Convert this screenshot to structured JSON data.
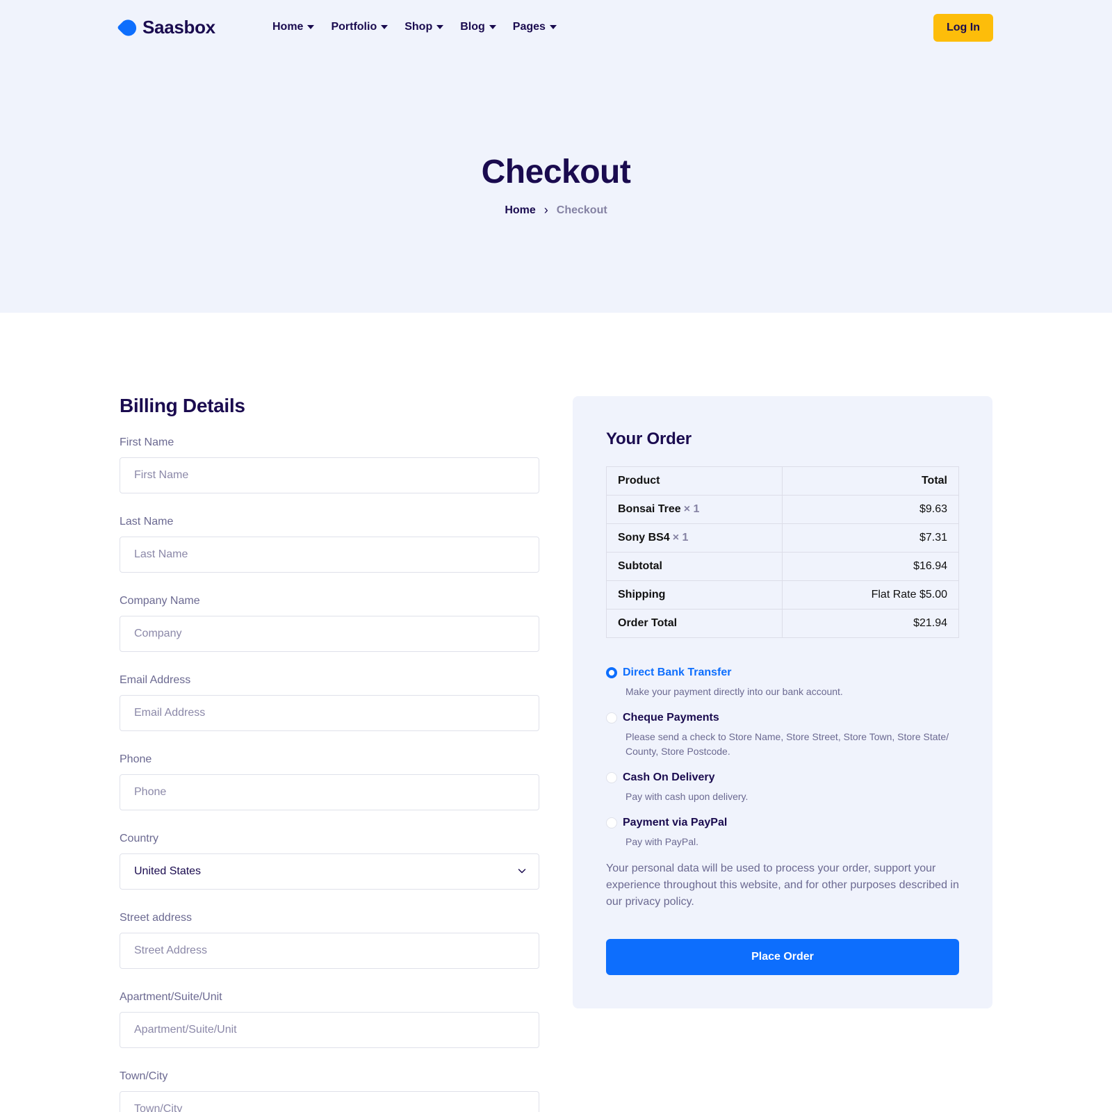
{
  "header": {
    "logo_text": "Saasbox",
    "nav": [
      {
        "label": "Home"
      },
      {
        "label": "Portfolio"
      },
      {
        "label": "Shop"
      },
      {
        "label": "Blog"
      },
      {
        "label": "Pages"
      }
    ],
    "login_label": "Log In"
  },
  "hero": {
    "title": "Checkout",
    "breadcrumb": {
      "home": "Home",
      "separator": "›",
      "current": "Checkout"
    }
  },
  "billing": {
    "title": "Billing Details",
    "fields": [
      {
        "label": "First Name",
        "placeholder": "First Name"
      },
      {
        "label": "Last Name",
        "placeholder": "Last Name"
      },
      {
        "label": "Company Name",
        "placeholder": "Company"
      },
      {
        "label": "Email Address",
        "placeholder": "Email Address"
      },
      {
        "label": "Phone",
        "placeholder": "Phone"
      }
    ],
    "country": {
      "label": "Country",
      "value": "United States"
    },
    "fields_after": [
      {
        "label": "Street address",
        "placeholder": "Street Address"
      },
      {
        "label": "Apartment/Suite/Unit",
        "placeholder": "Apartment/Suite/Unit"
      },
      {
        "label": "Town/City",
        "placeholder": "Town/City"
      }
    ]
  },
  "order": {
    "title": "Your Order",
    "table": {
      "headers": [
        "Product",
        "Total"
      ],
      "items": [
        {
          "name": "Bonsai Tree",
          "qty": "× 1",
          "total": "$9.63"
        },
        {
          "name": "Sony BS4",
          "qty": "× 1",
          "total": "$7.31"
        }
      ],
      "subtotal": {
        "label": "Subtotal",
        "value": "$16.94"
      },
      "shipping": {
        "label": "Shipping",
        "value": "Flat Rate $5.00"
      },
      "order_total": {
        "label": "Order Total",
        "value": "$21.94"
      }
    },
    "payments": [
      {
        "title": "Direct Bank Transfer",
        "desc": "Make your payment directly into our bank account.",
        "selected": true
      },
      {
        "title": "Cheque Payments",
        "desc": "Please send a check to Store Name, Store Street, Store Town, Store State/ County, Store Postcode.",
        "selected": false
      },
      {
        "title": "Cash On Delivery",
        "desc": "Pay with cash upon delivery.",
        "selected": false
      },
      {
        "title": "Payment via PayPal",
        "desc": "Pay with PayPal.",
        "selected": false
      }
    ],
    "privacy_text": "Your personal data will be used to process your order, support your experience throughout this website, and for other purposes described in our privacy policy.",
    "place_order_label": "Place Order"
  },
  "colors": {
    "primary": "#0d6efd",
    "accent": "#fdbd0a",
    "heading": "#1a0b4f",
    "hero_bg": "#f0f3fc"
  }
}
